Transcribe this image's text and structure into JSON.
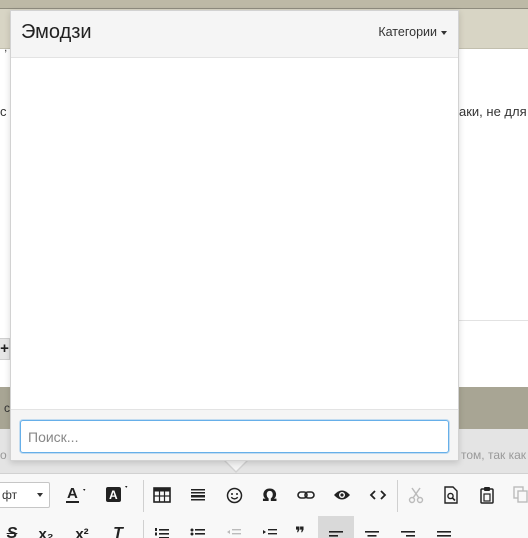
{
  "background": {
    "text_left_fragment": "с",
    "text_right_fragment": "аки,  не для",
    "hint_left_fragment": "о",
    "hint_right_fragment": "том, так как",
    "band_mark": ",",
    "dark_band_mark": "с",
    "plus_label": "+"
  },
  "emoji_popup": {
    "title": "Эмодзи",
    "categories_label": "Категории",
    "search": {
      "placeholder": "Поиск...",
      "value": ""
    }
  },
  "toolbar": {
    "font_select_value": "фт",
    "row1": [
      {
        "name": "text-color-button",
        "icon": "text-color-icon"
      },
      {
        "name": "background-color-button",
        "icon": "background-color-icon"
      },
      {
        "name": "table-button",
        "icon": "table-icon"
      },
      {
        "name": "horizontal-line-button",
        "icon": "horizontal-line-icon"
      },
      {
        "name": "emoji-button",
        "icon": "smiley-icon"
      },
      {
        "name": "special-char-button",
        "icon": "omega-icon"
      },
      {
        "name": "link-button",
        "icon": "link-icon"
      },
      {
        "name": "preview-button",
        "icon": "eye-icon"
      },
      {
        "name": "source-code-button",
        "icon": "code-icon"
      },
      {
        "name": "cut-button",
        "icon": "scissors-icon"
      },
      {
        "name": "find-button",
        "icon": "find-document-icon"
      },
      {
        "name": "paste-button",
        "icon": "clipboard-icon"
      },
      {
        "name": "copy-button",
        "icon": "copy-icon"
      }
    ],
    "row2": [
      {
        "name": "strikethrough-button",
        "icon": "strikethrough-icon",
        "label": "S"
      },
      {
        "name": "subscript-button",
        "icon": "subscript-icon",
        "label": "x₂"
      },
      {
        "name": "superscript-button",
        "icon": "superscript-icon",
        "label": "x²"
      },
      {
        "name": "clear-format-button",
        "icon": "clear-format-icon",
        "label": "T"
      },
      {
        "name": "numbered-list-button",
        "icon": "numbered-list-icon"
      },
      {
        "name": "bullet-list-button",
        "icon": "bullet-list-icon"
      },
      {
        "name": "outdent-button",
        "icon": "outdent-icon"
      },
      {
        "name": "indent-button",
        "icon": "indent-icon"
      },
      {
        "name": "blockquote-button",
        "icon": "quote-icon",
        "label": "❞"
      },
      {
        "name": "align-left-button",
        "icon": "align-left-icon"
      },
      {
        "name": "align-center-button",
        "icon": "align-center-icon"
      },
      {
        "name": "align-right-button",
        "icon": "align-right-icon"
      },
      {
        "name": "align-justify-button",
        "icon": "align-justify-icon"
      }
    ],
    "colors": {
      "accent_focus": "#66afe9",
      "toolbar_bg": "#f8f8f8",
      "active_bg": "#d9d9d9"
    }
  }
}
